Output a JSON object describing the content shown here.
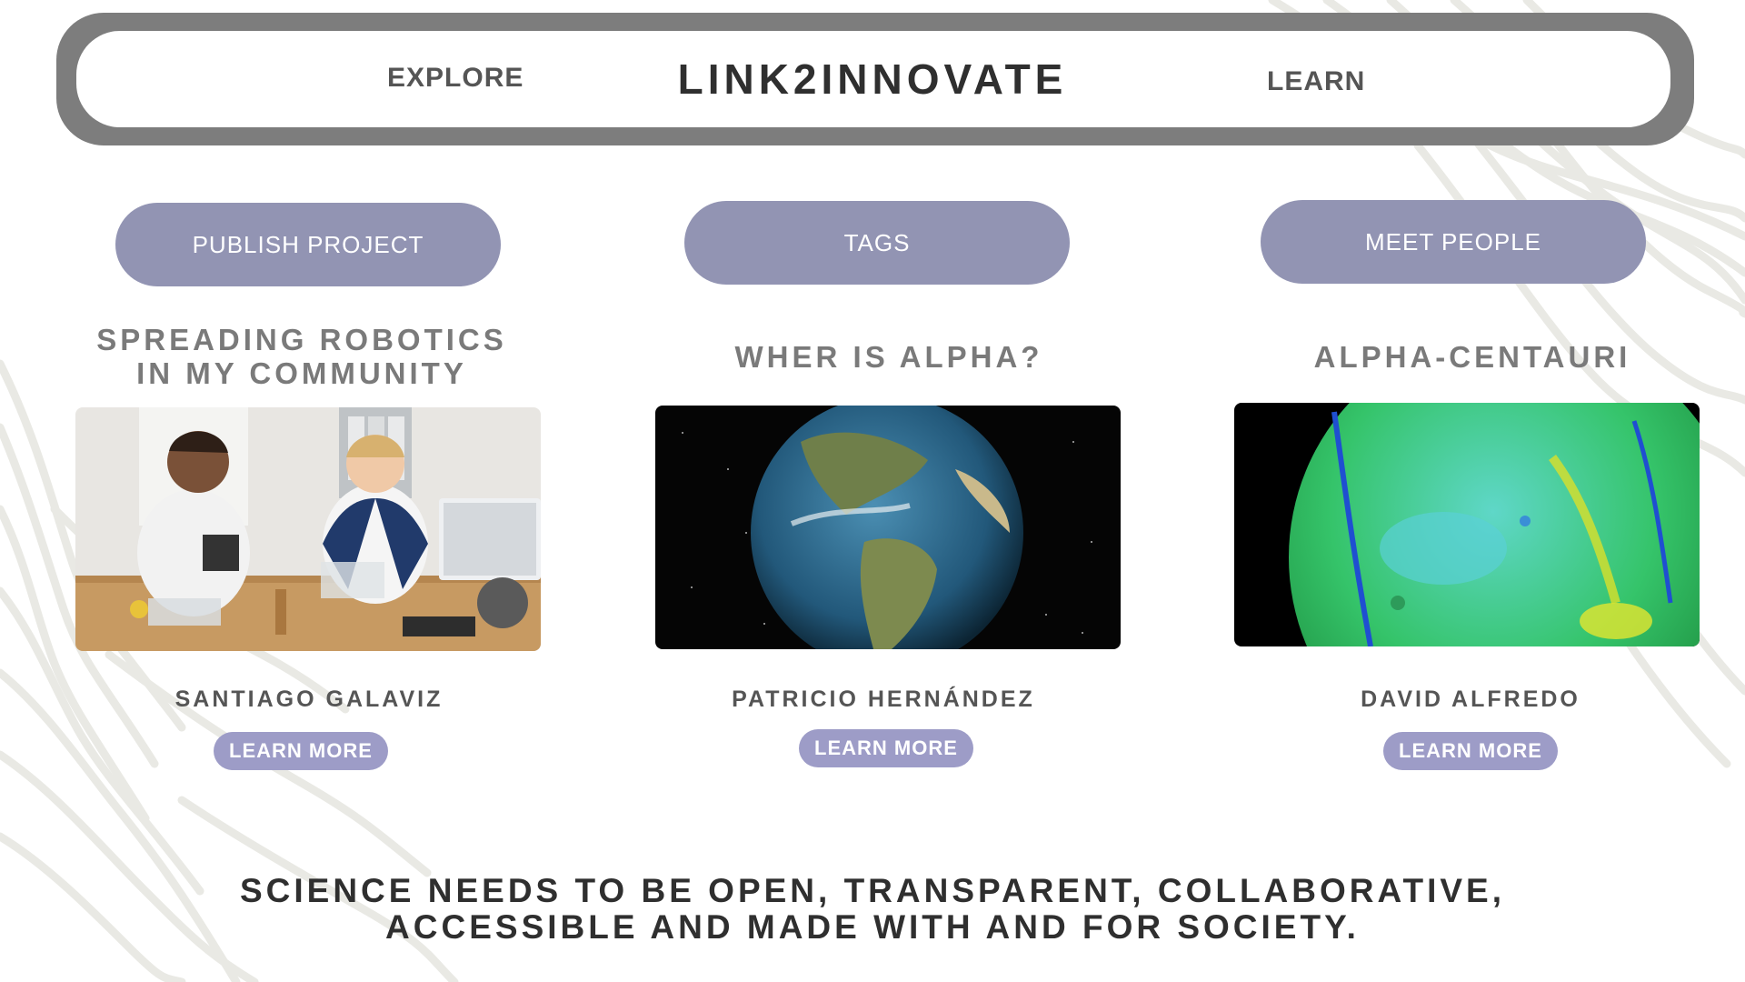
{
  "nav": {
    "explore_label": "EXPLORE",
    "brand": "LINK2INNOVATE",
    "learn_label": "LEARN"
  },
  "actions": {
    "publish_label": "PUBLISH PROJECT",
    "tags_label": "TAGS",
    "meet_label": "MEET PEOPLE"
  },
  "projects": [
    {
      "title_line1": "SPREADING ROBOTICS",
      "title_line2": "IN MY COMMUNITY",
      "image": "two-kids-building-robots-photo",
      "author": "SANTIAGO GALAVIZ",
      "button": "LEARN MORE"
    },
    {
      "title_line1": "WHER IS ALPHA?",
      "image": "earth-globe-in-space",
      "author": "PATRICIO HERNÁNDEZ",
      "button": "LEARN MORE"
    },
    {
      "title_line1": "ALPHA-CENTAURI",
      "image": "planet-topographic-map",
      "author": "DAVID ALFREDO",
      "button": "LEARN MORE"
    }
  ],
  "tagline": {
    "line1": "SCIENCE NEEDS TO BE OPEN, TRANSPARENT, COLLABORATIVE,",
    "line2": "ACCESSIBLE AND MADE WITH AND FOR SOCIETY."
  },
  "colors": {
    "nav_frame": "#7d7d7d",
    "pill": "#9294b3",
    "learn_button": "#9d9cc7",
    "heading_grey": "#7a7a7a"
  }
}
